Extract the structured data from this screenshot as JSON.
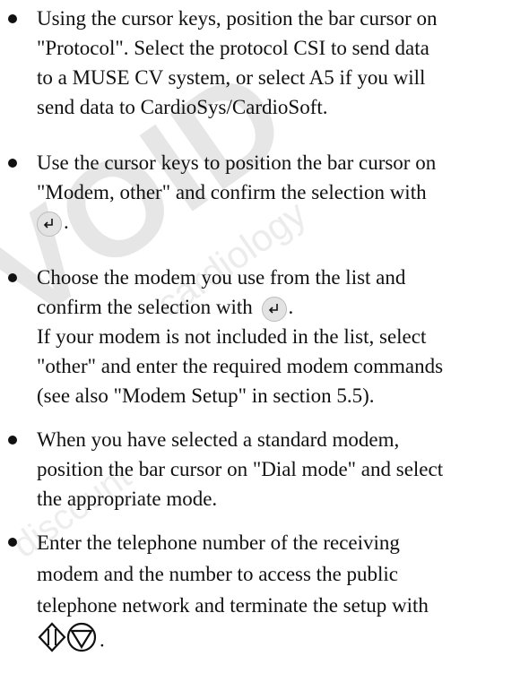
{
  "watermark": {
    "large": "VOID",
    "small_1": "cardiology",
    "small_2": "discount"
  },
  "bullets": [
    {
      "lines": [
        "Using the cursor keys, position the bar cursor on",
        "\"Protocol\". Select the protocol CSI to send data",
        "to a MUSE CV system, or select A5 if you will",
        "send data to CardioSys/CardioSoft."
      ]
    },
    {
      "lines": [
        "Use the cursor keys to position the bar cursor on",
        "\"Modem, other\" and confirm the selection with"
      ],
      "after_icon": "."
    },
    {
      "line_1": "Choose the modem you use from the list and",
      "line_2_before": "confirm the selection with",
      "line_2_after": ".",
      "lines_rest": [
        "If your modem is not included in the list, select",
        "\"other\" and enter the required modem commands",
        "(see also \"Modem Setup\" in section 5.5)."
      ]
    },
    {
      "lines": [
        "When you have selected a standard modem,",
        "position the bar cursor on \"Dial mode\" and select",
        "the appropriate mode."
      ]
    },
    {
      "lines": [
        "Enter the telephone number of the receiving",
        "modem and the number to access the public",
        "telephone network and terminate the setup with"
      ],
      "after_icon": "."
    }
  ],
  "icons": {
    "enter_key": "enter-key-icon",
    "start_stop": "start-stop-icon"
  }
}
